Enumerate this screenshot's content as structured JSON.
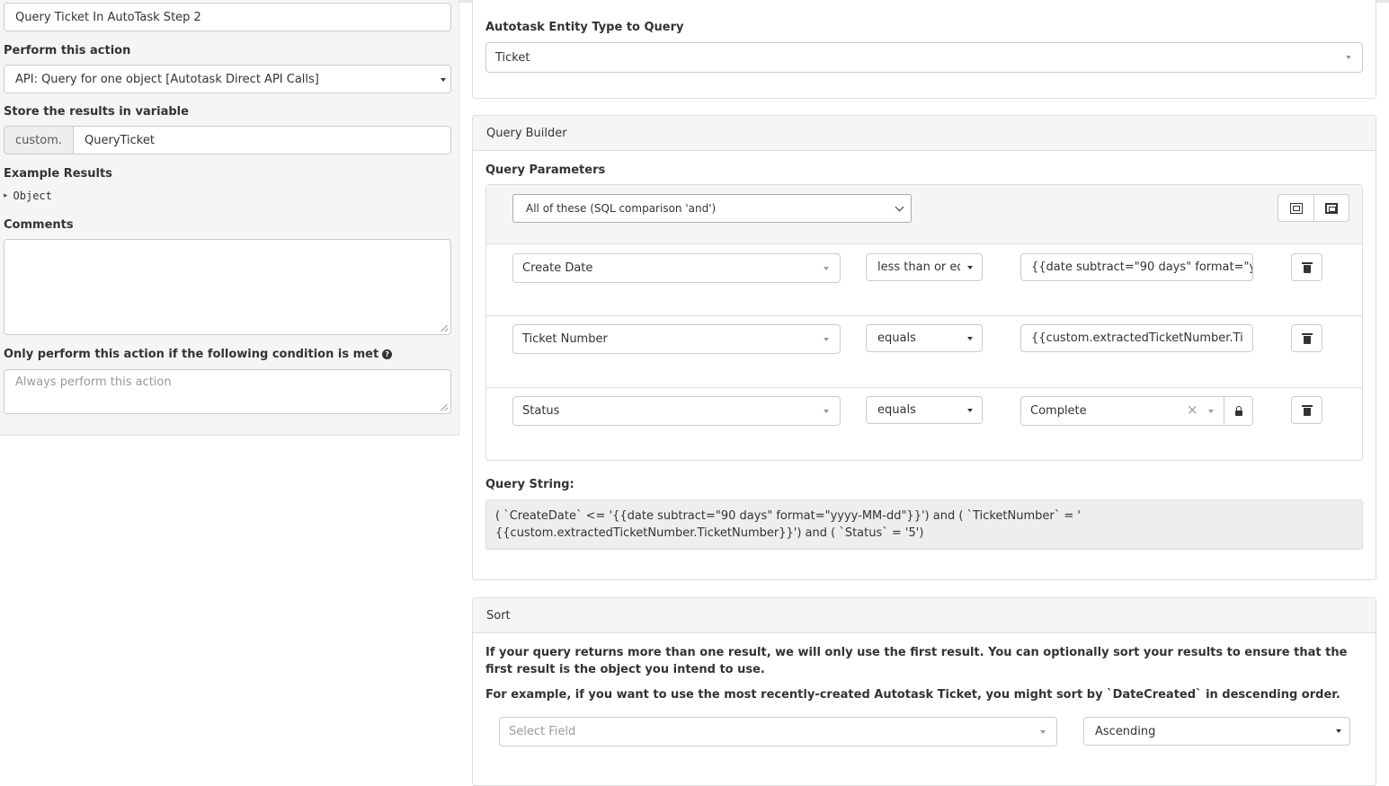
{
  "left_panel": {
    "step_name_value": "Query Ticket In AutoTask Step 2",
    "perform_action_label": "Perform this action",
    "perform_action_value": "API: Query for one object [Autotask Direct API Calls]",
    "store_results_label": "Store the results in variable",
    "variable_prefix": "custom.",
    "variable_name": "QueryTicket",
    "example_results_label": "Example Results",
    "example_results_toggle": "▸",
    "example_results_value": "Object",
    "comments_label": "Comments",
    "comments_value": "",
    "condition_label": "Only perform this action if the following condition is met",
    "condition_placeholder": "Always perform this action"
  },
  "entity_panel": {
    "label": "Autotask Entity Type to Query",
    "value": "Ticket"
  },
  "query_builder": {
    "title": "Query Builder",
    "params_label": "Query Parameters",
    "group_condition": "All of these (SQL comparison 'and')",
    "rows": [
      {
        "field": "Create Date",
        "operator": "less than or eq",
        "value": "{{date subtract=\"90 days\" format=\"y"
      },
      {
        "field": "Ticket Number",
        "operator": "equals",
        "value": "{{custom.extractedTicketNumber.Ti"
      },
      {
        "field": "Status",
        "operator": "equals",
        "value": "Complete",
        "clear": "×"
      }
    ],
    "query_string_label": "Query String:",
    "query_string_line1": "( `CreateDate` <= '{{date subtract=\"90 days\" format=\"yyyy-MM-dd\"}}') and ( `TicketNumber` = '",
    "query_string_line2": "{{custom.extractedTicketNumber.TicketNumber}}') and ( `Status` = '5')"
  },
  "sort_panel": {
    "title": "Sort",
    "text1": "If your query returns more than one result, we will only use the first result. You can optionally sort your results to ensure that the first result is the object you intend to use.",
    "text2": "For example, if you want to use the most recently-created Autotask Ticket, you might sort by `DateCreated` in descending order.",
    "field_placeholder": "Select Field",
    "direction_value": "Ascending"
  },
  "icons": {
    "help": "question-circle-icon",
    "delete": "trash-icon",
    "lock": "lock-icon",
    "collapse": "collapse-icon",
    "expand": "expand-icon"
  }
}
